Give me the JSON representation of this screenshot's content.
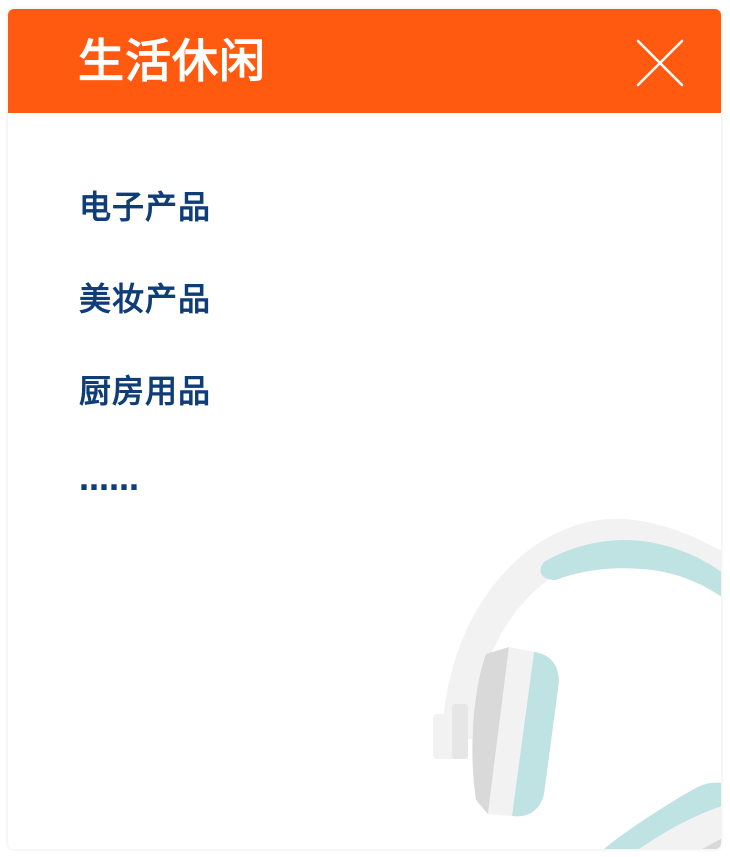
{
  "header": {
    "title": "生活休闲",
    "close_icon": "close-icon"
  },
  "menu": {
    "items": [
      {
        "label": "电子产品"
      },
      {
        "label": "美妆产品"
      },
      {
        "label": "厨房用品"
      }
    ],
    "more": "……"
  },
  "illustration": {
    "icon": "headphones-illustration"
  },
  "colors": {
    "header_bg": "#ff5a0f",
    "title_text": "#ffffff",
    "menu_text": "#0e3d78",
    "headphone_band": "#f2f2f2",
    "headphone_accent": "#bfe3e2",
    "headphone_shade": "#d9d9d9"
  }
}
